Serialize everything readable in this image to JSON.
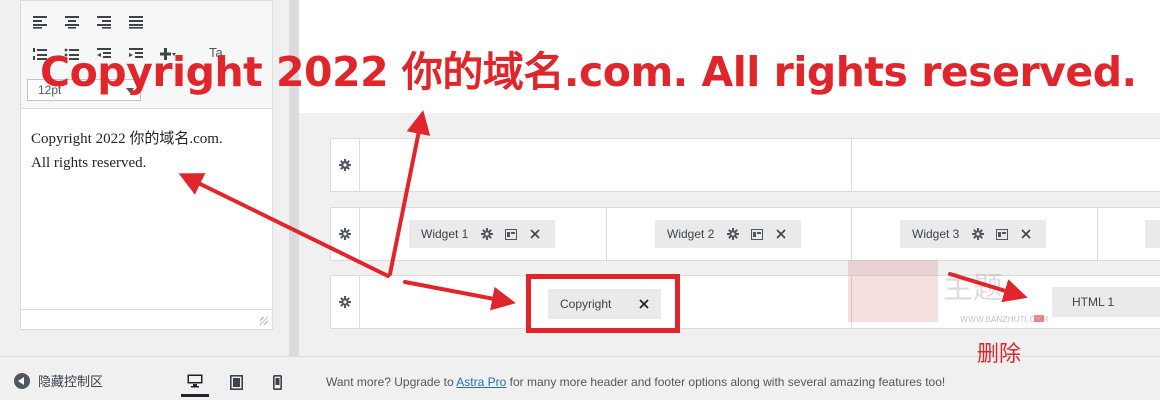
{
  "editor": {
    "font_size": "12pt",
    "toolbar_format_label": "Ta",
    "content_line1": "Copyright 2022 你的域名.com.",
    "content_line2": "All rights reserved."
  },
  "footer": {
    "collapse_label": "隐藏控制区",
    "upgrade_prefix": "Want more? Upgrade to ",
    "upgrade_link": "Astra Pro",
    "upgrade_suffix": " for many more header and footer options along with several amazing features too!"
  },
  "builder": {
    "widget_row": [
      "Widget 1",
      "Widget 2",
      "Widget 3"
    ],
    "copyright_item": "Copyright",
    "html_item": "HTML 1"
  },
  "annotation": {
    "caption": "Copyright 2022 你的域名.com. All rights reserved.",
    "delete_label": "删除",
    "watermark_text": "WWW.BANZHUTI.COM"
  },
  "colors": {
    "annotation_red": "#e0262b",
    "link_blue": "#2271b1"
  }
}
